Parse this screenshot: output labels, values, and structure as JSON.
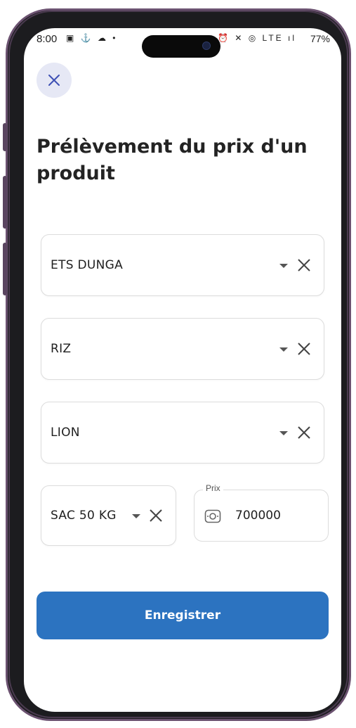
{
  "status_bar": {
    "time": "8:00",
    "left_icons": "▣ ⚓ ☁ •",
    "right_icons": "⏰ ✕ ◎ LTE ıl",
    "battery": "77%"
  },
  "header": {
    "close_icon": "close-icon",
    "title": "Prélèvement du prix d'un produit"
  },
  "form": {
    "supplier": {
      "value": "ETS DUNGA"
    },
    "product": {
      "value": "RIZ"
    },
    "brand": {
      "value": "LION"
    },
    "unit": {
      "value": "SAC 50 KG"
    },
    "price": {
      "label": "Prix",
      "value": "700000",
      "icon": "money-icon"
    }
  },
  "actions": {
    "save_label": "Enregistrer"
  },
  "colors": {
    "primary": "#2c73c0",
    "close_bg": "#e6e8f5",
    "close_icon": "#3f51b5",
    "device_frame": "#6b5270"
  }
}
